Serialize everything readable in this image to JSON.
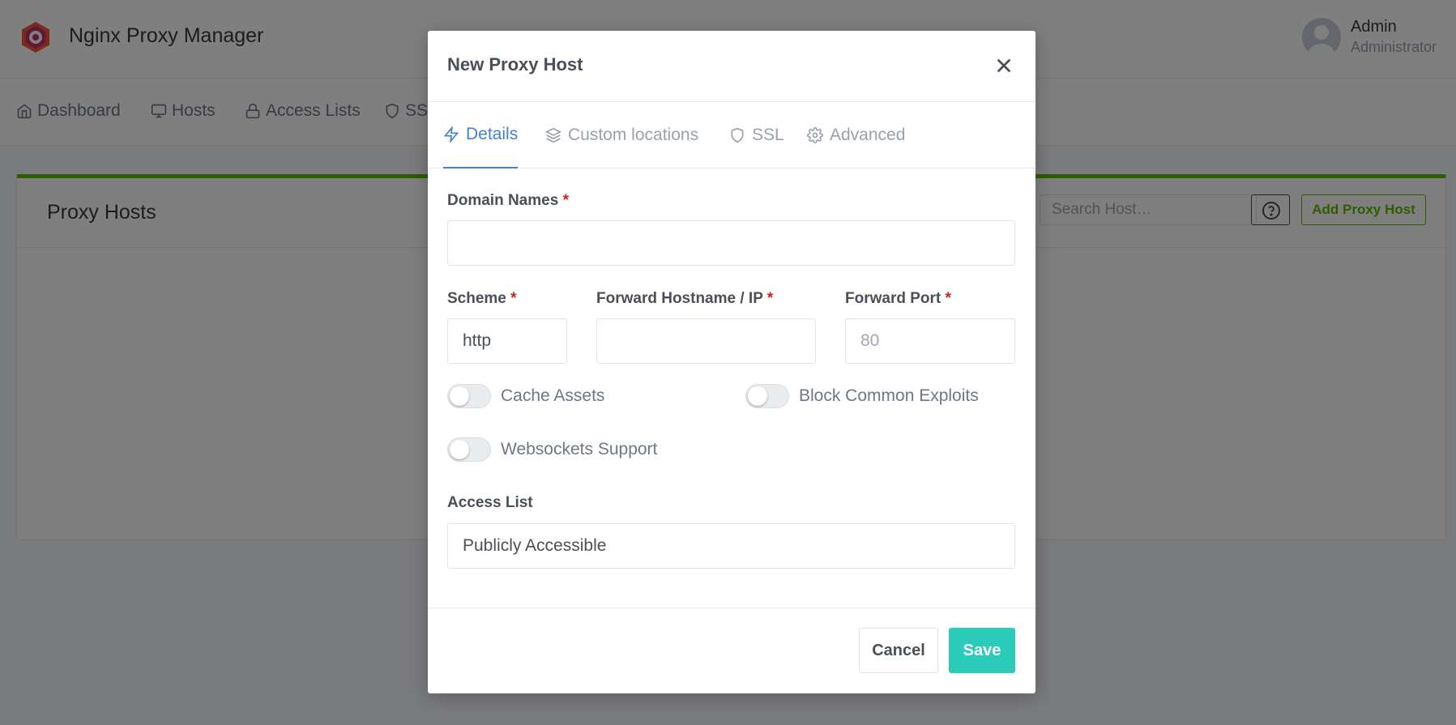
{
  "app": {
    "title": "Nginx Proxy Manager"
  },
  "user": {
    "name": "Admin",
    "role": "Administrator"
  },
  "nav": {
    "items": [
      {
        "label": "Dashboard",
        "icon": "home-icon"
      },
      {
        "label": "Hosts",
        "icon": "monitor-icon"
      },
      {
        "label": "Access Lists",
        "icon": "lock-icon"
      },
      {
        "label": "SSL",
        "icon": "shield-icon"
      }
    ]
  },
  "page": {
    "card_title": "Proxy Hosts",
    "search_placeholder": "Search Host…",
    "add_button": "Add Proxy Host"
  },
  "modal": {
    "title": "New Proxy Host",
    "tabs": [
      {
        "label": "Details",
        "icon": "zap-icon",
        "active": true
      },
      {
        "label": "Custom locations",
        "icon": "layers-icon",
        "active": false
      },
      {
        "label": "SSL",
        "icon": "shield-icon",
        "active": false
      },
      {
        "label": "Advanced",
        "icon": "settings-icon",
        "active": false
      }
    ],
    "domain_names": {
      "label": "Domain Names",
      "required": "*",
      "value": ""
    },
    "scheme": {
      "label": "Scheme",
      "required": "*",
      "value": "http"
    },
    "forward_host": {
      "label": "Forward Hostname / IP",
      "required": "*",
      "value": ""
    },
    "forward_port": {
      "label": "Forward Port",
      "required": "*",
      "placeholder": "80"
    },
    "toggles": {
      "cache_assets": {
        "label": "Cache Assets",
        "checked": false
      },
      "block_exploits": {
        "label": "Block Common Exploits",
        "checked": false
      },
      "websockets": {
        "label": "Websockets Support",
        "checked": false
      }
    },
    "access_list": {
      "label": "Access List",
      "value": "Publicly Accessible"
    },
    "cancel_label": "Cancel",
    "save_label": "Save"
  },
  "colors": {
    "accent_blue": "#467fcf",
    "success_green": "#5eba00",
    "save_teal": "#2bcbba",
    "required_red": "#cd201f"
  }
}
